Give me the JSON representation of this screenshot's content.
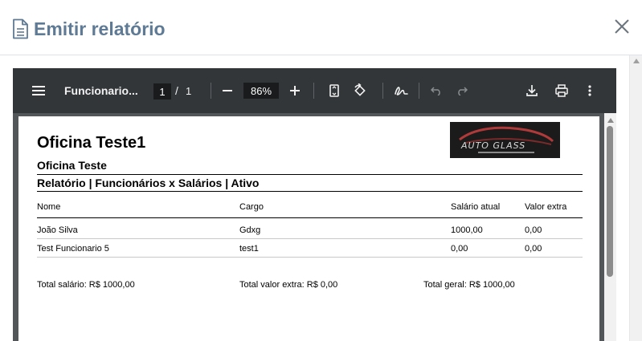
{
  "modal": {
    "title": "Emitir relatório",
    "icons": {
      "title_icon": "document-icon",
      "close_icon": "close-icon"
    }
  },
  "pdf_viewer": {
    "toolbar": {
      "document_name": "Funcionario...",
      "current_page": "1",
      "page_separator": "/",
      "total_pages": "1",
      "zoom": "86%",
      "icons": [
        "menu-icon",
        "zoom-out-icon",
        "zoom-in-icon",
        "fit-page-icon",
        "rotate-icon",
        "annotate-icon",
        "undo-icon",
        "redo-icon",
        "download-icon",
        "print-icon",
        "more-icon"
      ]
    }
  },
  "report": {
    "company": "Oficina Teste1",
    "subcompany": "Oficina Teste",
    "title": "Relatório | Funcionários x Salários | Ativo",
    "logo_text": "AUTO GLASS",
    "columns": [
      "Nome",
      "Cargo",
      "Salário atual",
      "Valor extra"
    ],
    "rows": [
      {
        "nome": "João Silva",
        "cargo": "Gdxg",
        "salario": "1000,00",
        "extra": "0,00"
      },
      {
        "nome": "Test Funcionario 5",
        "cargo": "test1",
        "salario": "0,00",
        "extra": "0,00"
      }
    ],
    "totals": {
      "salario": "Total salário: R$ 1000,00",
      "extra": "Total valor extra: R$ 0,00",
      "geral": "Total geral: R$ 1000,00"
    }
  },
  "colors": {
    "title": "#5e7a94",
    "toolbar_bg": "#323639",
    "viewer_bg": "#525659",
    "logo_accent": "#c0392b"
  }
}
